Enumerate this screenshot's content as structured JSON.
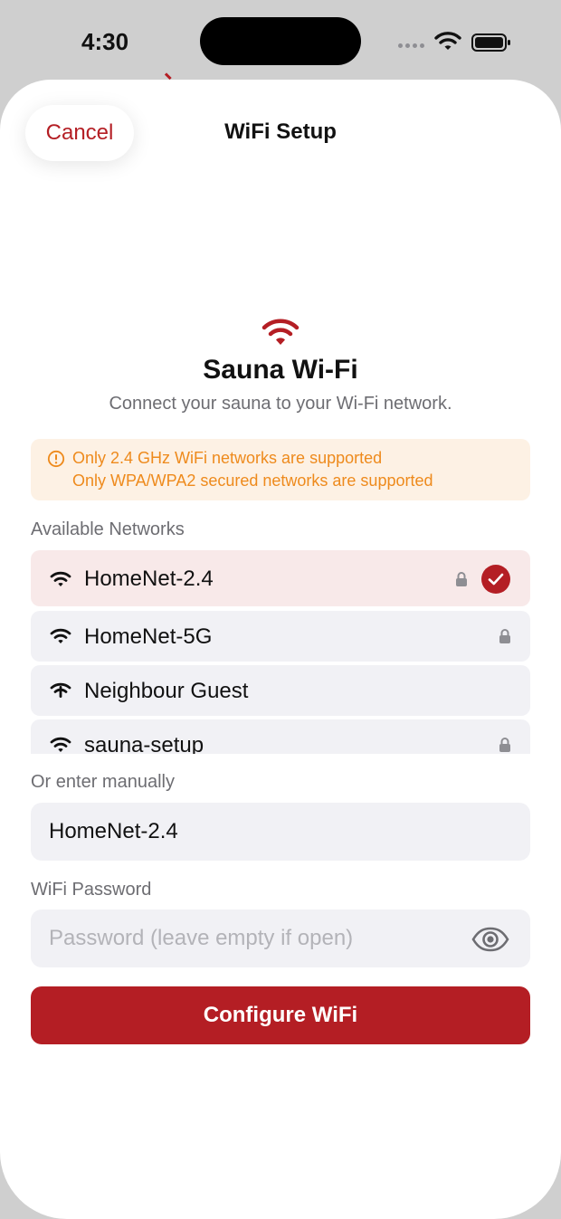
{
  "status_bar": {
    "time": "4:30"
  },
  "header": {
    "cancel_label": "Cancel",
    "title": "WiFi Setup"
  },
  "hero": {
    "icon": "wifi-icon",
    "title": "Sauna Wi-Fi",
    "subtitle": "Connect your sauna to your Wi-Fi network."
  },
  "notice": {
    "icon": "info-circle-icon",
    "lines": [
      "Only 2.4 GHz WiFi networks are supported",
      "Only WPA/WPA2 secured networks are supported"
    ]
  },
  "networks": {
    "section_label": "Available Networks",
    "items": [
      {
        "name": "HomeNet-2.4",
        "secured": true,
        "selected": true
      },
      {
        "name": "HomeNet-5G",
        "secured": true,
        "selected": false
      },
      {
        "name": "Neighbour Guest",
        "secured": false,
        "selected": false
      },
      {
        "name": "sauna-setup",
        "secured": true,
        "selected": false
      }
    ]
  },
  "manual": {
    "section_label": "Or enter manually",
    "ssid_value": "HomeNet-2.4"
  },
  "password": {
    "section_label": "WiFi Password",
    "placeholder": "Password (leave empty if open)",
    "toggle_icon": "eye-icon"
  },
  "primary_action": {
    "label": "Configure WiFi"
  },
  "colors": {
    "accent": "#b41e24",
    "notice_text": "#ee8a1c",
    "notice_bg": "#fdf1e4",
    "selected_row_bg": "#f8e9e9",
    "field_bg": "#f1f1f5"
  }
}
